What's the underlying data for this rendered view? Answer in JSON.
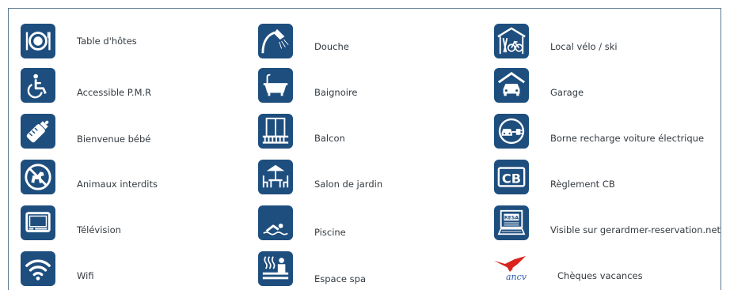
{
  "colors": {
    "icon_bg": "#1e4e7e",
    "text": "#333a40",
    "ancv_red": "#d9231d",
    "ancv_blue": "#2a5aa8"
  },
  "amenities": {
    "col1": [
      {
        "label": "Table d'hôtes",
        "icon": "plate-cutlery-icon"
      },
      {
        "label": "Accessible P.M.R",
        "icon": "wheelchair-icon"
      },
      {
        "label": "Bienvenue bébé",
        "icon": "baby-bottle-icon"
      },
      {
        "label": "Animaux interdits",
        "icon": "no-pets-icon"
      },
      {
        "label": "Télévision",
        "icon": "television-icon"
      },
      {
        "label": "Wifi",
        "icon": "wifi-icon"
      }
    ],
    "col2": [
      {
        "label": "Douche",
        "icon": "shower-icon"
      },
      {
        "label": "Baignoire",
        "icon": "bathtub-icon"
      },
      {
        "label": "Balcon",
        "icon": "balcony-icon"
      },
      {
        "label": "Salon de jardin",
        "icon": "garden-furniture-icon"
      },
      {
        "label": "Piscine",
        "icon": "swimmer-icon"
      },
      {
        "label": "Espace spa",
        "icon": "spa-icon"
      }
    ],
    "col3": [
      {
        "label": "Local vélo / ski",
        "icon": "bike-ski-storage-icon"
      },
      {
        "label": "Garage",
        "icon": "garage-icon"
      },
      {
        "label": "Borne recharge voiture électrique",
        "icon": "ev-charging-icon"
      },
      {
        "label": "Règlement CB",
        "icon": "credit-card-icon",
        "icon_text": "CB"
      },
      {
        "label": "Visible sur gerardmer-reservation.net",
        "icon": "online-booking-icon",
        "icon_text": "RESA"
      },
      {
        "label": "Chèques vacances",
        "icon": "ancv-logo",
        "icon_text": "ancv"
      }
    ]
  }
}
